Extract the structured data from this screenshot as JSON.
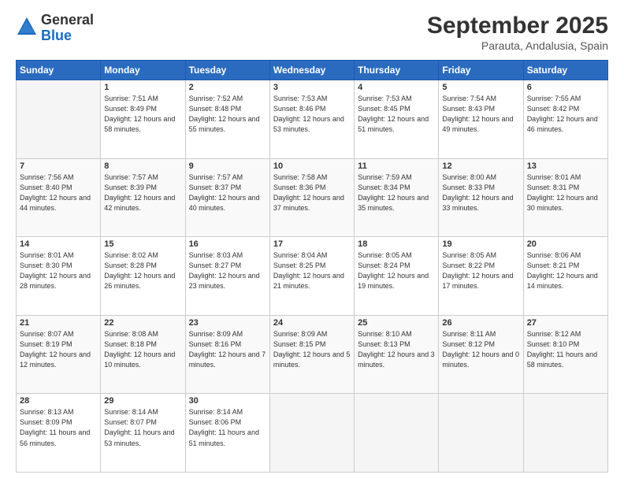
{
  "header": {
    "logo_line1": "General",
    "logo_line2": "Blue",
    "month": "September 2025",
    "location": "Parauta, Andalusia, Spain"
  },
  "weekdays": [
    "Sunday",
    "Monday",
    "Tuesday",
    "Wednesday",
    "Thursday",
    "Friday",
    "Saturday"
  ],
  "weeks": [
    [
      {
        "day": "",
        "info": ""
      },
      {
        "day": "1",
        "info": "Sunrise: 7:51 AM\nSunset: 8:49 PM\nDaylight: 12 hours\nand 58 minutes."
      },
      {
        "day": "2",
        "info": "Sunrise: 7:52 AM\nSunset: 8:48 PM\nDaylight: 12 hours\nand 55 minutes."
      },
      {
        "day": "3",
        "info": "Sunrise: 7:53 AM\nSunset: 8:46 PM\nDaylight: 12 hours\nand 53 minutes."
      },
      {
        "day": "4",
        "info": "Sunrise: 7:53 AM\nSunset: 8:45 PM\nDaylight: 12 hours\nand 51 minutes."
      },
      {
        "day": "5",
        "info": "Sunrise: 7:54 AM\nSunset: 8:43 PM\nDaylight: 12 hours\nand 49 minutes."
      },
      {
        "day": "6",
        "info": "Sunrise: 7:55 AM\nSunset: 8:42 PM\nDaylight: 12 hours\nand 46 minutes."
      }
    ],
    [
      {
        "day": "7",
        "info": "Sunrise: 7:56 AM\nSunset: 8:40 PM\nDaylight: 12 hours\nand 44 minutes."
      },
      {
        "day": "8",
        "info": "Sunrise: 7:57 AM\nSunset: 8:39 PM\nDaylight: 12 hours\nand 42 minutes."
      },
      {
        "day": "9",
        "info": "Sunrise: 7:57 AM\nSunset: 8:37 PM\nDaylight: 12 hours\nand 40 minutes."
      },
      {
        "day": "10",
        "info": "Sunrise: 7:58 AM\nSunset: 8:36 PM\nDaylight: 12 hours\nand 37 minutes."
      },
      {
        "day": "11",
        "info": "Sunrise: 7:59 AM\nSunset: 8:34 PM\nDaylight: 12 hours\nand 35 minutes."
      },
      {
        "day": "12",
        "info": "Sunrise: 8:00 AM\nSunset: 8:33 PM\nDaylight: 12 hours\nand 33 minutes."
      },
      {
        "day": "13",
        "info": "Sunrise: 8:01 AM\nSunset: 8:31 PM\nDaylight: 12 hours\nand 30 minutes."
      }
    ],
    [
      {
        "day": "14",
        "info": "Sunrise: 8:01 AM\nSunset: 8:30 PM\nDaylight: 12 hours\nand 28 minutes."
      },
      {
        "day": "15",
        "info": "Sunrise: 8:02 AM\nSunset: 8:28 PM\nDaylight: 12 hours\nand 26 minutes."
      },
      {
        "day": "16",
        "info": "Sunrise: 8:03 AM\nSunset: 8:27 PM\nDaylight: 12 hours\nand 23 minutes."
      },
      {
        "day": "17",
        "info": "Sunrise: 8:04 AM\nSunset: 8:25 PM\nDaylight: 12 hours\nand 21 minutes."
      },
      {
        "day": "18",
        "info": "Sunrise: 8:05 AM\nSunset: 8:24 PM\nDaylight: 12 hours\nand 19 minutes."
      },
      {
        "day": "19",
        "info": "Sunrise: 8:05 AM\nSunset: 8:22 PM\nDaylight: 12 hours\nand 17 minutes."
      },
      {
        "day": "20",
        "info": "Sunrise: 8:06 AM\nSunset: 8:21 PM\nDaylight: 12 hours\nand 14 minutes."
      }
    ],
    [
      {
        "day": "21",
        "info": "Sunrise: 8:07 AM\nSunset: 8:19 PM\nDaylight: 12 hours\nand 12 minutes."
      },
      {
        "day": "22",
        "info": "Sunrise: 8:08 AM\nSunset: 8:18 PM\nDaylight: 12 hours\nand 10 minutes."
      },
      {
        "day": "23",
        "info": "Sunrise: 8:09 AM\nSunset: 8:16 PM\nDaylight: 12 hours\nand 7 minutes."
      },
      {
        "day": "24",
        "info": "Sunrise: 8:09 AM\nSunset: 8:15 PM\nDaylight: 12 hours\nand 5 minutes."
      },
      {
        "day": "25",
        "info": "Sunrise: 8:10 AM\nSunset: 8:13 PM\nDaylight: 12 hours\nand 3 minutes."
      },
      {
        "day": "26",
        "info": "Sunrise: 8:11 AM\nSunset: 8:12 PM\nDaylight: 12 hours\nand 0 minutes."
      },
      {
        "day": "27",
        "info": "Sunrise: 8:12 AM\nSunset: 8:10 PM\nDaylight: 11 hours\nand 58 minutes."
      }
    ],
    [
      {
        "day": "28",
        "info": "Sunrise: 8:13 AM\nSunset: 8:09 PM\nDaylight: 11 hours\nand 56 minutes."
      },
      {
        "day": "29",
        "info": "Sunrise: 8:14 AM\nSunset: 8:07 PM\nDaylight: 11 hours\nand 53 minutes."
      },
      {
        "day": "30",
        "info": "Sunrise: 8:14 AM\nSunset: 8:06 PM\nDaylight: 11 hours\nand 51 minutes."
      },
      {
        "day": "",
        "info": ""
      },
      {
        "day": "",
        "info": ""
      },
      {
        "day": "",
        "info": ""
      },
      {
        "day": "",
        "info": ""
      }
    ]
  ]
}
